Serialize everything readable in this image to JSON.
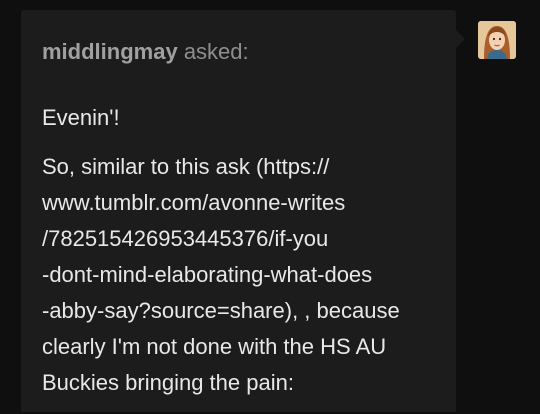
{
  "ask": {
    "asker": "middlingmay",
    "asked_label": "asked:",
    "greeting": "Evenin'!",
    "body_lines": [
      "So, similar to this ask (https://",
      "www.tumblr.com/avonne-writes",
      "/782515426953445376/if-you",
      "-dont-mind-elaborating-what-does",
      "-abby-say?source=share), , because",
      "clearly I'm not done with the HS AU",
      "Buckies bringing the pain:"
    ]
  },
  "avatar": {
    "icon": "portrait-avatar-icon"
  },
  "colors": {
    "background": "#0f0f0f",
    "card": "#1c1c1c",
    "text": "#e8e8e8",
    "asker": "#a0a0a0"
  }
}
